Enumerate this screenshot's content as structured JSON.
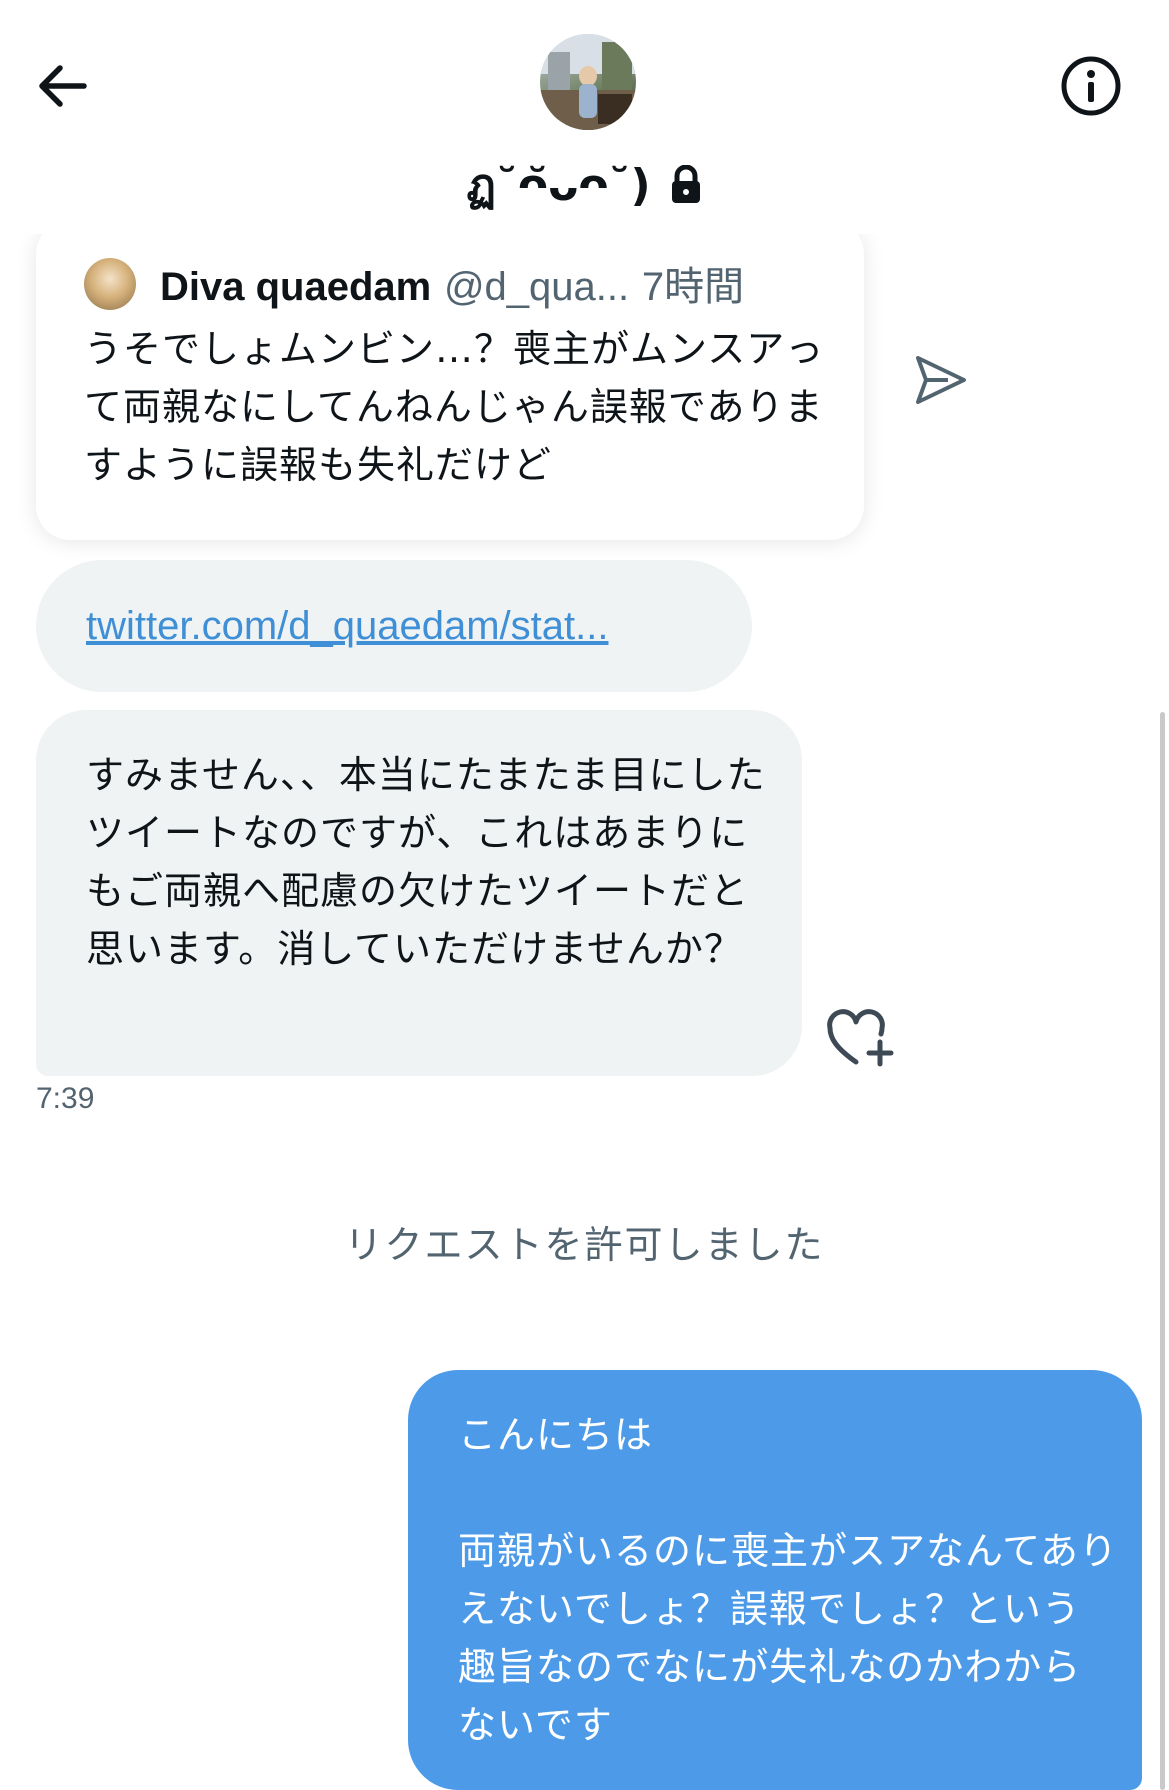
{
  "header": {
    "title": "ฏ˘ᴖ̆ᴗᴖ˘)",
    "back_icon": "arrow-left-icon",
    "info_icon": "info-icon",
    "lock_icon": "lock-icon"
  },
  "quoted_tweet": {
    "name": "Diva quaedam",
    "handle": "@d_qua...",
    "time": "7時間",
    "text": "うそでしょムンビン…？喪主がムンスアって両親なにしてんねんじゃん誤報でありますように誤報も失礼だけど"
  },
  "link": {
    "text": "twitter.com/d_quaedam/stat..."
  },
  "received_message": {
    "text": "すみません、、本当にたまたま目にしたツイートなのですが、これはあまりにもご両親へ配慮の欠けたツイートだと思います。消していただけませんか？",
    "time": "7:39"
  },
  "system_message": "リクエストを許可しました",
  "sent_message": {
    "text": "こんにちは\n\n両親がいるのに喪主がスアなんてありえないでしょ？誤報でしょ？という趣旨なのでなにが失礼なのかわからないです"
  },
  "colors": {
    "sent_bubble": "#4d9be8",
    "received_bubble": "#eff3f4",
    "link": "#3f8fd6",
    "muted_text": "#536471"
  }
}
